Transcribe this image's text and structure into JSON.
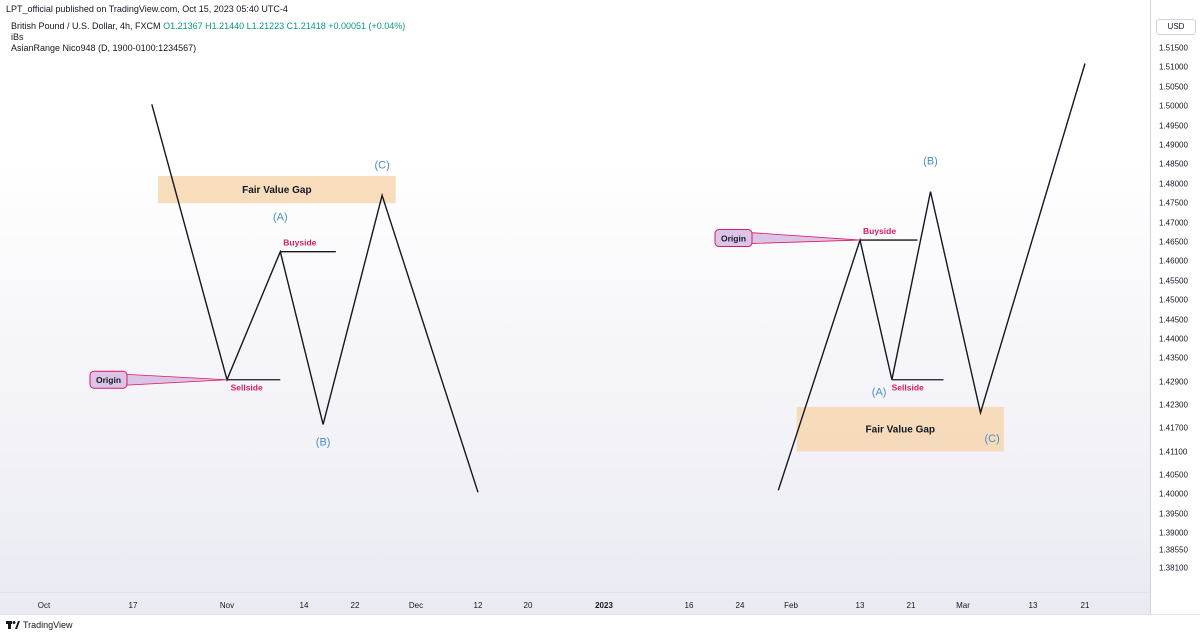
{
  "header": {
    "published": "LPT_official published on TradingView.com, Oct 15, 2023 05:40 UTC-4"
  },
  "legend": {
    "symbol": "British Pound / U.S. Dollar, 4h, FXCM",
    "ohlc": "O1.21367 H1.21440 L1.21223 C1.21418 +0.00051 (+0.04%)",
    "indicator1": "iBs",
    "indicator2": "AsianRange Nico948 (D, 1900-0100:1234567)"
  },
  "price_axis": {
    "currency": "USD"
  },
  "footer": {
    "brand": "TradingView"
  },
  "chart_data": {
    "type": "line",
    "y_ticks": [
      "1.51500",
      "1.51000",
      "1.50500",
      "1.50000",
      "1.49500",
      "1.49000",
      "1.48500",
      "1.48000",
      "1.47500",
      "1.47000",
      "1.46500",
      "1.46000",
      "1.45500",
      "1.45000",
      "1.44500",
      "1.44000",
      "1.43500",
      "1.42900",
      "1.42300",
      "1.41700",
      "1.41100",
      "1.40500",
      "1.40000",
      "1.39500",
      "1.39000",
      "1.38550",
      "1.38100"
    ],
    "x_ticks": [
      {
        "label": "Oct",
        "bold": false
      },
      {
        "label": "17",
        "bold": false
      },
      {
        "label": "Nov",
        "bold": false
      },
      {
        "label": "14",
        "bold": false
      },
      {
        "label": "22",
        "bold": false
      },
      {
        "label": "Dec",
        "bold": false
      },
      {
        "label": "12",
        "bold": false
      },
      {
        "label": "20",
        "bold": false
      },
      {
        "label": "2023",
        "bold": true
      },
      {
        "label": "16",
        "bold": false
      },
      {
        "label": "24",
        "bold": false
      },
      {
        "label": "Feb",
        "bold": false
      },
      {
        "label": "13",
        "bold": false
      },
      {
        "label": "21",
        "bold": false
      },
      {
        "label": "Mar",
        "bold": false
      },
      {
        "label": "13",
        "bold": false
      },
      {
        "label": "21",
        "bold": false
      }
    ],
    "left_structure": {
      "path": [
        {
          "date": "Oct 20",
          "price": 1.5005
        },
        {
          "date": "Nov 1",
          "price": 1.4295
        },
        {
          "date": "Nov 10",
          "price": 1.4625
        },
        {
          "date": "Nov 17",
          "price": 1.418
        },
        {
          "date": "Nov 26",
          "price": 1.477
        },
        {
          "date": "Dec 12",
          "price": 1.4005
        }
      ],
      "labels": [
        {
          "text": "(A)",
          "date": "Nov 10",
          "price": 1.4705
        },
        {
          "text": "(B)",
          "date": "Nov 17",
          "price": 1.4125
        },
        {
          "text": "(C)",
          "date": "Nov 26",
          "price": 1.484
        }
      ],
      "levels": [
        {
          "name": "Buyside",
          "price": 1.4625,
          "from": "Nov 10",
          "to": "Nov 19"
        },
        {
          "name": "Sellside",
          "price": 1.4295,
          "from": "Nov 1",
          "to": "Nov 10"
        }
      ],
      "fvg": {
        "label": "Fair Value Gap",
        "from": "Oct 21",
        "to": "Nov 28",
        "top": 1.482,
        "bottom": 1.475
      },
      "origin": {
        "label": "Origin",
        "price": 1.4295
      }
    },
    "right_structure": {
      "path": [
        {
          "date": "Jan 30",
          "price": 1.401
        },
        {
          "date": "Feb 13",
          "price": 1.4655
        },
        {
          "date": "Feb 18",
          "price": 1.4295
        },
        {
          "date": "Feb 24",
          "price": 1.478
        },
        {
          "date": "Mar 4",
          "price": 1.421
        },
        {
          "date": "Mar 21",
          "price": 1.511
        }
      ],
      "labels": [
        {
          "text": "(A)",
          "date": "Feb 16",
          "price": 1.4255
        },
        {
          "text": "(B)",
          "date": "Feb 24",
          "price": 1.485
        },
        {
          "text": "(C)",
          "date": "Mar 6",
          "price": 1.4135
        }
      ],
      "levels": [
        {
          "name": "Buyside",
          "price": 1.4655,
          "from": "Feb 13",
          "to": "Feb 22"
        },
        {
          "name": "Sellside",
          "price": 1.4295,
          "from": "Feb 18",
          "to": "Feb 26"
        }
      ],
      "fvg": {
        "label": "Fair Value Gap",
        "from": "Feb 2",
        "to": "Mar 8",
        "top": 1.4225,
        "bottom": 1.411
      },
      "origin": {
        "label": "Origin",
        "price": 1.4655
      }
    },
    "colors": {
      "line": "#131722",
      "label_blue": "#4a8fc7",
      "level_text": "#d81b60",
      "fvg_fill": "#f6d7b0",
      "origin_fill": "#dcc4e8",
      "origin_stroke": "#d81b60"
    }
  }
}
